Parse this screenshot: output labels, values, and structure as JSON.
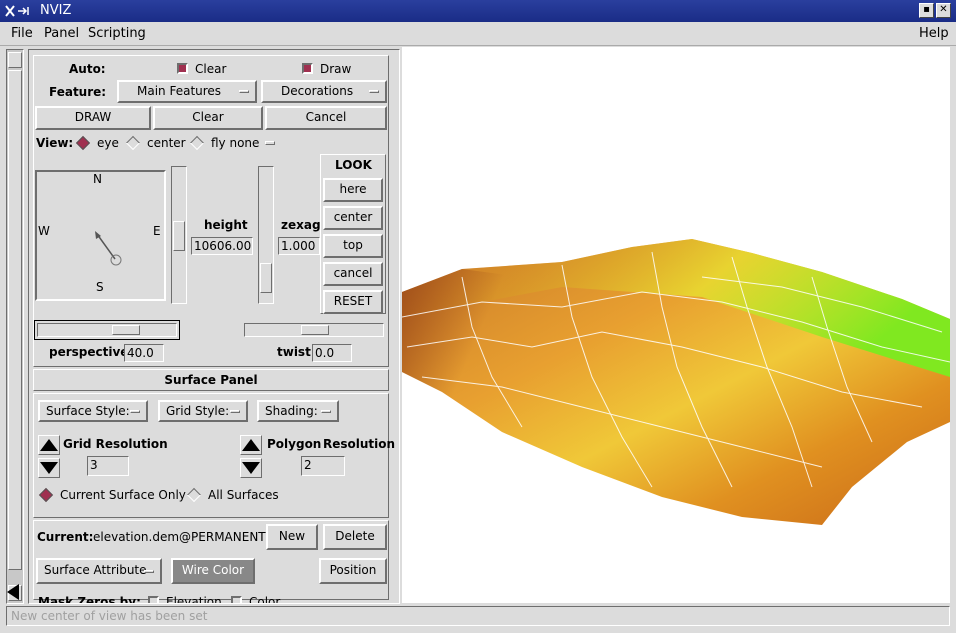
{
  "window": {
    "title": "NVIZ"
  },
  "menubar": {
    "file": "File",
    "panel": "Panel",
    "scripting": "Scripting",
    "help": "Help"
  },
  "auto": {
    "label": "Auto:",
    "clear": "Clear",
    "draw": "Draw"
  },
  "feature": {
    "label": "Feature:",
    "main": "Main Features",
    "decorations": "Decorations"
  },
  "actions": {
    "draw": "DRAW",
    "clear": "Clear",
    "cancel": "Cancel"
  },
  "view": {
    "label": "View:",
    "eye": "eye",
    "center": "center",
    "fly": "fly none"
  },
  "compass": {
    "n": "N",
    "s": "S",
    "e": "E",
    "w": "W"
  },
  "height": {
    "label": "height",
    "value": "10606.00"
  },
  "zexag": {
    "label": "zexag",
    "value": "1.000"
  },
  "look": {
    "title": "LOOK",
    "here": "here",
    "center": "center",
    "top": "top",
    "cancel": "cancel",
    "reset": "RESET"
  },
  "perspective": {
    "label": "perspective",
    "value": "40.0"
  },
  "twist": {
    "label": "twist",
    "value": "0.0"
  },
  "surface_panel": {
    "title": "Surface Panel",
    "surface_style": "Surface Style:",
    "grid_style": "Grid Style:",
    "shading": "Shading:",
    "grid_res_label": "Grid Resolution",
    "grid_res_value": "3",
    "poly_label": "Polygon",
    "res_label": "Resolution",
    "poly_res_value": "2",
    "current_only": "Current Surface Only",
    "all_surfaces": "All Surfaces",
    "current_label": "Current:",
    "current_value": "elevation.dem@PERMANENT",
    "new": "New",
    "delete": "Delete",
    "surface_attribute": "Surface Attribute",
    "wire_color": "Wire Color",
    "position": "Position",
    "mask_label": "Mask Zeros by:",
    "mask_elevation": "Elevation",
    "mask_color": "Color"
  },
  "status": {
    "message": "New center of view has been set"
  }
}
